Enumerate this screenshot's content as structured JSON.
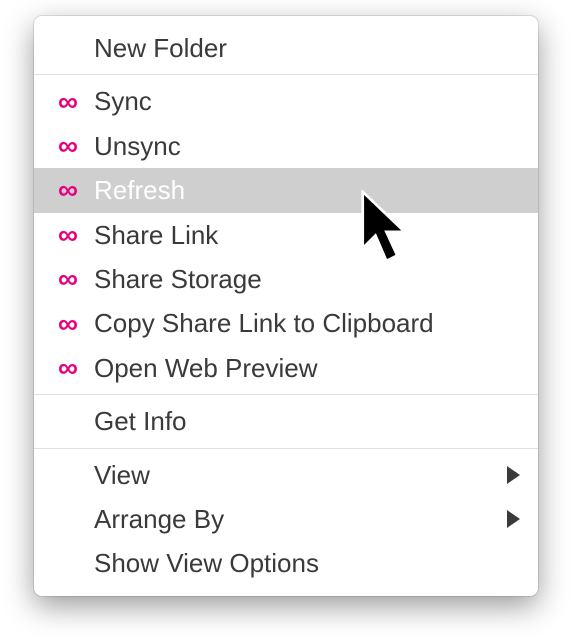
{
  "menu": {
    "groups": [
      {
        "items": [
          {
            "label": "New Folder",
            "icon": false,
            "submenu": false
          }
        ]
      },
      {
        "items": [
          {
            "label": "Sync",
            "icon": true,
            "submenu": false
          },
          {
            "label": "Unsync",
            "icon": true,
            "submenu": false
          },
          {
            "label": "Refresh",
            "icon": true,
            "submenu": false,
            "highlight": true
          },
          {
            "label": "Share Link",
            "icon": true,
            "submenu": false
          },
          {
            "label": "Share Storage",
            "icon": true,
            "submenu": false
          },
          {
            "label": "Copy Share Link to Clipboard",
            "icon": true,
            "submenu": false
          },
          {
            "label": "Open Web Preview",
            "icon": true,
            "submenu": false
          }
        ]
      },
      {
        "items": [
          {
            "label": "Get Info",
            "icon": false,
            "submenu": false
          }
        ]
      },
      {
        "items": [
          {
            "label": "View",
            "icon": false,
            "submenu": true
          },
          {
            "label": "Arrange By",
            "icon": false,
            "submenu": true
          },
          {
            "label": "Show View Options",
            "icon": false,
            "submenu": false
          }
        ]
      }
    ]
  },
  "colors": {
    "infinity": "#e6007e"
  }
}
